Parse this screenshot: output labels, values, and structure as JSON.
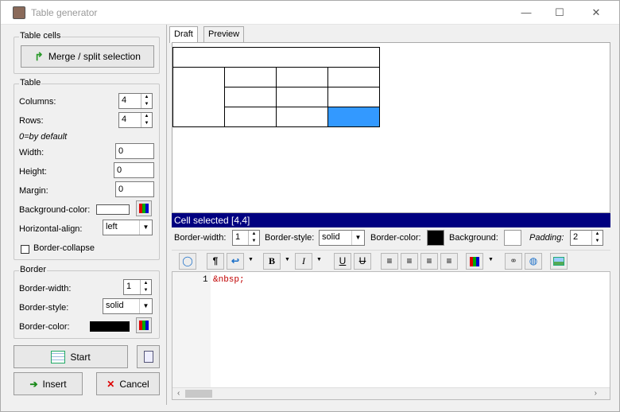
{
  "window": {
    "title": "Table generator",
    "controls": {
      "minimize": "—",
      "maximize": "☐",
      "close": "✕"
    }
  },
  "table_cells": {
    "legend": "Table cells",
    "merge_label": "Merge / split selection"
  },
  "table": {
    "legend": "Table",
    "columns_label": "Columns:",
    "columns": "4",
    "rows_label": "Rows:",
    "rows": "4",
    "hint": "0=by default",
    "width_label": "Width:",
    "width": "0",
    "height_label": "Height:",
    "height": "0",
    "margin_label": "Margin:",
    "margin": "0",
    "bg_label": "Background-color:",
    "halign_label": "Horizontal-align:",
    "halign": "left",
    "collapse_label": "Border-collapse"
  },
  "border": {
    "legend": "Border",
    "width_label": "Border-width:",
    "width": "1",
    "style_label": "Border-style:",
    "style": "solid",
    "color_label": "Border-color:"
  },
  "buttons": {
    "start": "Start",
    "insert": "Insert",
    "cancel": "Cancel"
  },
  "tabs": [
    "Draft",
    "Preview"
  ],
  "cell_selected": "Cell selected [4,4]",
  "cell_props": {
    "border_width_label": "Border-width:",
    "border_width": "1",
    "border_style_label": "Border-style:",
    "border_style": "solid",
    "border_color_label": "Border-color:",
    "background_label": "Background:",
    "padding_label": "Padding:",
    "padding": "2"
  },
  "editor": {
    "line_number": "1",
    "code": "&nbsp;"
  },
  "colors": {
    "selected_cell": "#3399ff",
    "title_bar": "#000080",
    "code_text": "#c00000"
  }
}
